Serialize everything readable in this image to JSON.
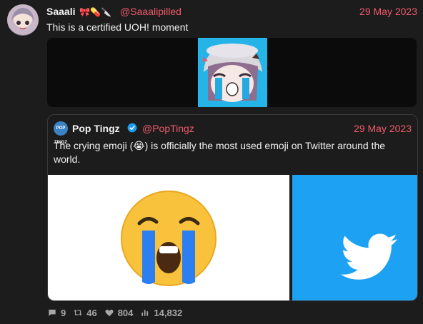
{
  "tweet": {
    "author_name": "Saaali",
    "author_emojis": "🎀💊🔪",
    "handle": "@Saaalipilled",
    "date": "29 May 2023",
    "text": "This is a certified UOH! moment"
  },
  "quoted": {
    "avatar_text": "POP TINGZ",
    "author_name": "Pop Tingz",
    "handle": "@PopTingz",
    "date": "29 May 2023",
    "text": "The crying emoji (😭) is officially the most used emoji on Twitter around the world."
  },
  "stats": {
    "replies": "9",
    "retweets": "46",
    "likes": "804",
    "views": "14,832"
  },
  "colors": {
    "accent": "#f05a6a",
    "twitter_blue": "#1da1f2"
  }
}
